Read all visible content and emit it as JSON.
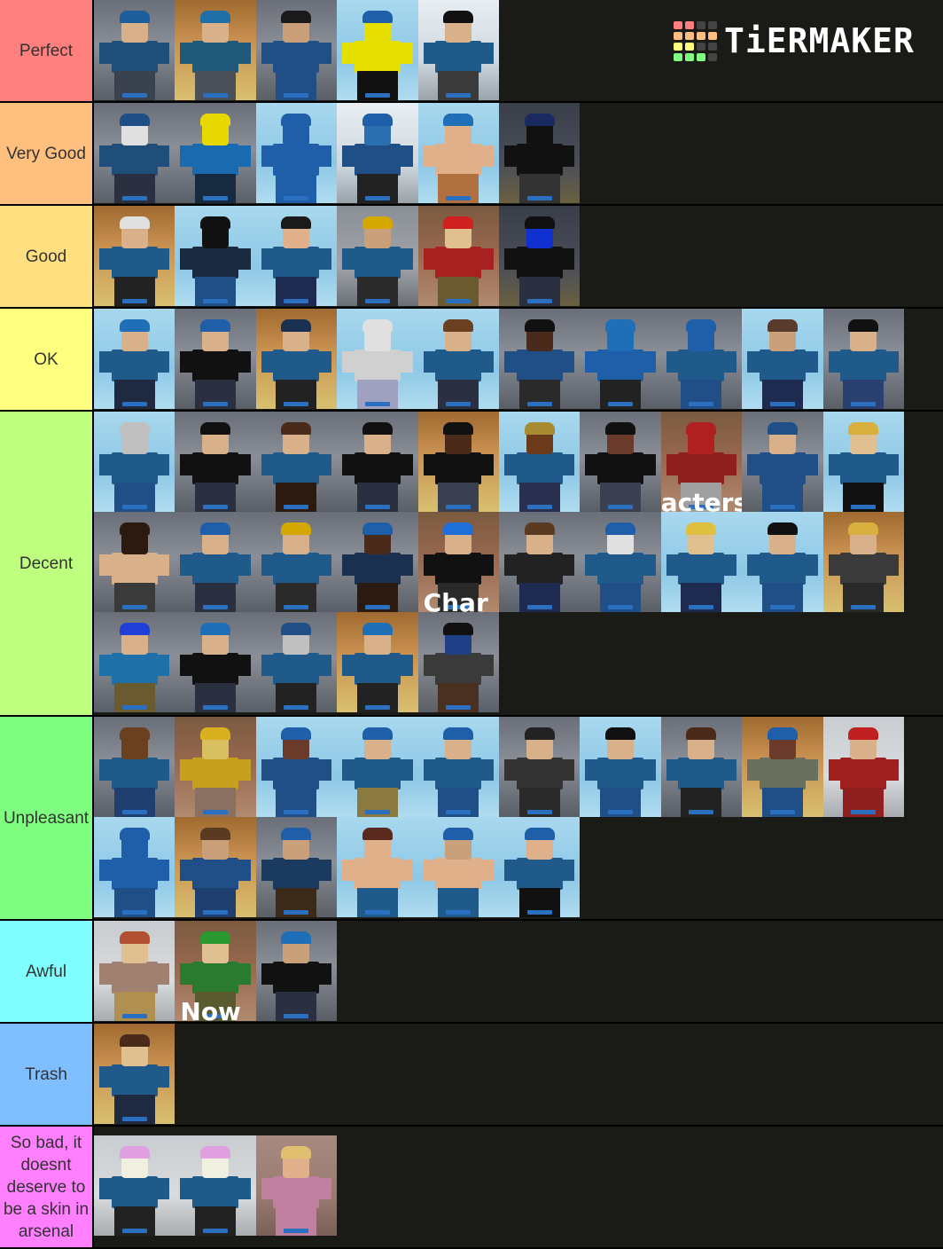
{
  "brand": {
    "name": "TiERMAKER",
    "grid_colors": [
      "#ff7f7f",
      "#ff7f7f",
      "#444444",
      "#444444",
      "#ffbf7f",
      "#ffbf7f",
      "#ffbf7f",
      "#ffbf7f",
      "#ffff7f",
      "#ffff7f",
      "#444444",
      "#444444",
      "#7fff7f",
      "#7fff7f",
      "#7fff7f",
      "#444444"
    ]
  },
  "background_color": "#1a1a17",
  "tiers": [
    {
      "label": "Perfect",
      "color": "#ff7f7f",
      "height_rows": 1,
      "items": [
        {
          "name": "blue-beanie-default",
          "scene": "gray",
          "hat": "#1f5e9c",
          "skin": "#d8b08a",
          "torso": "#1f4e7a",
          "legs": "#3a4250"
        },
        {
          "name": "beanie-sunglasses",
          "scene": "orange",
          "hat": "#1f6fa8",
          "skin": "#d8b08a",
          "torso": "#1f5a7a",
          "legs": "#4a5058"
        },
        {
          "name": "bearded-suit",
          "scene": "gray",
          "hat": "#1a1a1a",
          "skin": "#c9a07a",
          "torso": "#1f4f86",
          "legs": "#1f4f86"
        },
        {
          "name": "noob-grenade",
          "scene": "sky",
          "hat": "#1f5ea8",
          "skin": "#e6e000",
          "torso": "#e6e000",
          "legs": "#111111"
        },
        {
          "name": "agent-pistol",
          "scene": "white",
          "hat": "#111111",
          "skin": "#d8b08a",
          "torso": "#1f5a8a",
          "legs": "#3a3a3a"
        }
      ]
    },
    {
      "label": "Very Good",
      "color": "#ffbf7f",
      "height_rows": 1,
      "items": [
        {
          "name": "skull-mask-hoodie",
          "scene": "gray",
          "hat": "#1f4e86",
          "skin": "#e0e0e0",
          "torso": "#1f4e7a",
          "legs": "#2a3040"
        },
        {
          "name": "noob-smile",
          "scene": "gray",
          "hat": "#e6d800",
          "skin": "#e6d800",
          "torso": "#1a6ab0",
          "legs": "#172a40"
        },
        {
          "name": "brick-wall",
          "scene": "sky",
          "hat": "#1f5ea8",
          "skin": "#1f5ea8",
          "torso": "#1f5ea8",
          "legs": "#1f5ea8"
        },
        {
          "name": "bandana-hat-split",
          "scene": "white",
          "hat": "#1f5ea8",
          "skin": "#2a6fb0",
          "torso": "#1f4f86",
          "legs": "#222222"
        },
        {
          "name": "swim-ring",
          "scene": "sky",
          "hat": "#1f6fb8",
          "skin": "#e0b08a",
          "torso": "#e0b08a",
          "legs": "#b07040"
        },
        {
          "name": "goggles-helmet-black",
          "scene": "dark",
          "hat": "#1a2a60",
          "skin": "#111111",
          "torso": "#111111",
          "legs": "#333333"
        }
      ]
    },
    {
      "label": "Good",
      "color": "#ffdf7f",
      "height_rows": 1,
      "items": [
        {
          "name": "white-helmet-visor",
          "scene": "orange",
          "hat": "#e0e0e0",
          "skin": "#d8b08a",
          "torso": "#1f5a8a",
          "legs": "#222222"
        },
        {
          "name": "tactical-black-armor",
          "scene": "sky",
          "hat": "#111111",
          "skin": "#111111",
          "torso": "#1a2a40",
          "legs": "#1f4f86"
        },
        {
          "name": "lightsaber-mask",
          "scene": "sky",
          "hat": "#1a1a1a",
          "skin": "#e0b08a",
          "torso": "#1f5a8a",
          "legs": "#1f2a50"
        },
        {
          "name": "king-crown-beard",
          "scene": "stair",
          "hat": "#d4a800",
          "skin": "#c9a07a",
          "torso": "#1f5a8a",
          "legs": "#2a2a2a"
        },
        {
          "name": "roblox-shirt-helmet",
          "scene": "brick",
          "hat": "#d02020",
          "skin": "#e0c090",
          "torso": "#a82020",
          "legs": "#6a5a30"
        },
        {
          "name": "blue-visor-mask",
          "scene": "dark",
          "hat": "#111111",
          "skin": "#1030d0",
          "torso": "#111111",
          "legs": "#2a3040"
        }
      ]
    },
    {
      "label": "OK",
      "color": "#ffff7f",
      "height_rows": 1,
      "items": [
        {
          "name": "beanie-rifle-beard",
          "scene": "sky",
          "hat": "#1f6fb8",
          "skin": "#d8b08a",
          "torso": "#1f5a8a",
          "legs": "#1f2a40"
        },
        {
          "name": "beret-vest",
          "scene": "gray",
          "hat": "#1f5ea8",
          "skin": "#d8b08a",
          "torso": "#111111",
          "legs": "#2a3040"
        },
        {
          "name": "police-cap",
          "scene": "orange",
          "hat": "#1a3050",
          "skin": "#d8b08a",
          "torso": "#1f5a8a",
          "legs": "#222222"
        },
        {
          "name": "newspaper-robot",
          "scene": "sky",
          "hat": "#e0e0e0",
          "skin": "#e0e0e0",
          "torso": "#d0d0d0",
          "legs": "#a0a0c0"
        },
        {
          "name": "rifle-soldier",
          "scene": "sky",
          "hat": "#6a4020",
          "skin": "#d8b08a",
          "torso": "#1f5a8a",
          "legs": "#2a3040"
        },
        {
          "name": "bowler-hat-suit",
          "scene": "gray",
          "hat": "#111111",
          "skin": "#4a2a1a",
          "torso": "#1f4f86",
          "legs": "#2a2a2a"
        },
        {
          "name": "ski-mask-tank",
          "scene": "gray",
          "hat": "#1f6fb8",
          "skin": "#1f6fb8",
          "torso": "#1f5ea8",
          "legs": "#222222"
        },
        {
          "name": "full-hood-ninja",
          "scene": "gray",
          "hat": "#1f5ea8",
          "skin": "#1f5ea8",
          "torso": "#1f5a8a",
          "legs": "#1f4f86"
        },
        {
          "name": "cap-beard-hammer",
          "scene": "sky",
          "hat": "#5a3a2a",
          "skin": "#c9a07a",
          "torso": "#1f5a8a",
          "legs": "#1f2a50"
        },
        {
          "name": "long-hair-sunglasses",
          "scene": "gray",
          "hat": "#111111",
          "skin": "#d8b08a",
          "torso": "#1f5a8a",
          "legs": "#2a4070"
        }
      ]
    },
    {
      "label": "Decent",
      "color": "#bfff7f",
      "height_rows": 3,
      "items": [
        {
          "name": "alien-coat",
          "scene": "sky",
          "hat": "#c0c0c0",
          "skin": "#c0c0c0",
          "torso": "#1f5a8a",
          "legs": "#1f4f86"
        },
        {
          "name": "headset-vest-1",
          "scene": "gray",
          "hat": "#111111",
          "skin": "#d8b08a",
          "torso": "#111111",
          "legs": "#2a3040"
        },
        {
          "name": "x-strap-outfit",
          "scene": "gray",
          "hat": "#4a2a1a",
          "skin": "#d8b08a",
          "torso": "#1f5a8a",
          "legs": "#2a1a10"
        },
        {
          "name": "headset-vest-2",
          "scene": "gray",
          "hat": "#111111",
          "skin": "#d8b08a",
          "torso": "#111111",
          "legs": "#2a3040"
        },
        {
          "name": "hooded-vest-dark",
          "scene": "orange",
          "hat": "#111111",
          "skin": "#4a2a1a",
          "torso": "#111111",
          "legs": "#3a4050"
        },
        {
          "name": "straw-hat-rifle",
          "scene": "sky",
          "hat": "#a88a30",
          "skin": "#6a3a1a",
          "torso": "#1f5a8a",
          "legs": "#2a3050"
        },
        {
          "name": "sunglasses-vest-dark",
          "scene": "gray",
          "hat": "#111111",
          "skin": "#6a3a2a",
          "torso": "#111111",
          "legs": "#3a4050"
        },
        {
          "name": "spartan-characters",
          "scene": "brick",
          "hat": "#b02020",
          "skin": "#b02020",
          "torso": "#902020",
          "legs": "#a0a0a0",
          "overlay": "acters"
        },
        {
          "name": "fedora-suit",
          "scene": "gray",
          "hat": "#1f4f86",
          "skin": "#d8b08a",
          "torso": "#1f4f86",
          "legs": "#1f4f86"
        },
        {
          "name": "headset-blonde",
          "scene": "sky",
          "hat": "#d8b040",
          "skin": "#e0c090",
          "torso": "#1f5a8a",
          "legs": "#111111"
        },
        {
          "name": "balaclava-gun",
          "scene": "gray",
          "hat": "#2a1a10",
          "skin": "#2a1a10",
          "torso": "#d8b08a",
          "legs": "#3a3a3a"
        },
        {
          "name": "pirate-hat-coat",
          "scene": "gray",
          "hat": "#1f5ea8",
          "skin": "#d8b08a",
          "torso": "#1f5a8a",
          "legs": "#2a3040"
        },
        {
          "name": "crown-girl",
          "scene": "gray",
          "hat": "#d4a800",
          "skin": "#d8b08a",
          "torso": "#1f5a8a",
          "legs": "#2a2a2a"
        },
        {
          "name": "hard-hat-dark",
          "scene": "gray",
          "hat": "#1f5ea8",
          "skin": "#4a2a1a",
          "torso": "#1a3050",
          "legs": "#2a1a10"
        },
        {
          "name": "blue-helmet-camera",
          "scene": "brick",
          "hat": "#1f6fd8",
          "skin": "#d8b08a",
          "torso": "#111111",
          "legs": "#2a2a2a",
          "overlay": "Char"
        },
        {
          "name": "brown-hair-jacket",
          "scene": "gray",
          "hat": "#5a3a20",
          "skin": "#d8b08a",
          "torso": "#222222",
          "legs": "#1f2a50"
        },
        {
          "name": "wizard-beard",
          "scene": "gray",
          "hat": "#1f5ea8",
          "skin": "#e0e0e0",
          "torso": "#1f5a8a",
          "legs": "#1f4f86"
        },
        {
          "name": "claw-blonde",
          "scene": "sky",
          "hat": "#e0c040",
          "skin": "#e0c090",
          "torso": "#1f5a8a",
          "legs": "#1f2a50"
        },
        {
          "name": "sunglasses-rifle-coat",
          "scene": "sky",
          "hat": "#111111",
          "skin": "#d8b08a",
          "torso": "#1f5a8a",
          "legs": "#1f4f86"
        },
        {
          "name": "headset-gun-blonde",
          "scene": "orange",
          "hat": "#d8b040",
          "skin": "#d8b08a",
          "torso": "#3a3a3a",
          "legs": "#2a2a2a"
        },
        {
          "name": "blue-hair-smile",
          "scene": "gray",
          "hat": "#1f3fd8",
          "skin": "#d8b08a",
          "torso": "#1f6fa8",
          "legs": "#6a5a30"
        },
        {
          "name": "beanie-vest-smirk",
          "scene": "gray",
          "hat": "#1f6fb8",
          "skin": "#d8b08a",
          "torso": "#111111",
          "legs": "#2a3040"
        },
        {
          "name": "teeth-mask-hood",
          "scene": "gray",
          "hat": "#1f4f86",
          "skin": "#c0c0c0",
          "torso": "#1f5a8a",
          "legs": "#222222"
        },
        {
          "name": "eyepatch-beret",
          "scene": "orange",
          "hat": "#1f6fb8",
          "skin": "#d8b08a",
          "torso": "#1f5a8a",
          "legs": "#222222"
        },
        {
          "name": "cowgirl-bandana",
          "scene": "gray",
          "hat": "#111111",
          "skin": "#1f3f86",
          "torso": "#3a3a3a",
          "legs": "#4a3020"
        }
      ]
    },
    {
      "label": "Unpleasant",
      "color": "#7fff7f",
      "height_rows": 2,
      "items": [
        {
          "name": "bearded-lumberjack",
          "scene": "gray",
          "hat": "#6a4020",
          "skin": "#6a4020",
          "torso": "#1f5a8a",
          "legs": "#1f3f70"
        },
        {
          "name": "chef-gold",
          "scene": "brick",
          "hat": "#d8b020",
          "skin": "#d8c060",
          "torso": "#c8a020",
          "legs": "#8a7060"
        },
        {
          "name": "firefighter",
          "scene": "sky",
          "hat": "#1f5ea8",
          "skin": "#6a3a2a",
          "torso": "#1f4f86",
          "legs": "#1f4f86"
        },
        {
          "name": "beanie-shotgun",
          "scene": "sky",
          "hat": "#1f5ea8",
          "skin": "#d8b08a",
          "torso": "#1f5a8a",
          "legs": "#8a7a40"
        },
        {
          "name": "mustache-cap",
          "scene": "sky",
          "hat": "#1f5ea8",
          "skin": "#d8b08a",
          "torso": "#1f5a8a",
          "legs": "#1f4f86"
        },
        {
          "name": "cowboy-vest",
          "scene": "gray",
          "hat": "#222222",
          "skin": "#d8b08a",
          "torso": "#333333",
          "legs": "#2a2a2a"
        },
        {
          "name": "top-hat-masked",
          "scene": "sky",
          "hat": "#111111",
          "skin": "#d8b08a",
          "torso": "#1f5a8a",
          "legs": "#1f4f86"
        },
        {
          "name": "hoodie-brown-hair",
          "scene": "gray",
          "hat": "#4a2a1a",
          "skin": "#d8b08a",
          "torso": "#1f5a8a",
          "legs": "#222222"
        },
        {
          "name": "witch-hat-poncho",
          "scene": "orange",
          "hat": "#1f5ea8",
          "skin": "#6a3a2a",
          "torso": "#6a7060",
          "legs": "#1f4f86"
        },
        {
          "name": "red-hood-megaphone",
          "scene": "light",
          "hat": "#c02020",
          "skin": "#d8b08a",
          "torso": "#a02020",
          "legs": "#902020"
        },
        {
          "name": "blue-hood-pistol",
          "scene": "sky",
          "hat": "#1f5ea8",
          "skin": "#1f5ea8",
          "torso": "#1f5ea8",
          "legs": "#1f4f86"
        },
        {
          "name": "eyepatch-suspenders",
          "scene": "orange",
          "hat": "#5a3a20",
          "skin": "#c9a07a",
          "torso": "#1f4f86",
          "legs": "#1f3f70"
        },
        {
          "name": "hard-hat-poncho",
          "scene": "gray",
          "hat": "#1f5ea8",
          "skin": "#c9a07a",
          "torso": "#1a3a60",
          "legs": "#3a2a1a"
        },
        {
          "name": "banana-shirtless",
          "scene": "sky",
          "hat": "#5a2a20",
          "skin": "#e0b08a",
          "torso": "#e0b08a",
          "legs": "#1f5a8a"
        },
        {
          "name": "shirtless-sunglasses",
          "scene": "sky",
          "hat": "#1f5ea8",
          "skin": "#c9a07a",
          "torso": "#e0b08a",
          "legs": "#1f5a8a"
        },
        {
          "name": "headband-tank",
          "scene": "sky",
          "hat": "#1f5ea8",
          "skin": "#e0b08a",
          "torso": "#1f5a8a",
          "legs": "#111111"
        }
      ]
    },
    {
      "label": "Awful",
      "color": "#7fffff",
      "height_rows": 1,
      "items": [
        {
          "name": "megaphone-sweater",
          "scene": "light",
          "hat": "#b05030",
          "skin": "#e0c090",
          "torso": "#a08070",
          "legs": "#b09050"
        },
        {
          "name": "green-cap-racket",
          "scene": "brick",
          "hat": "#2a9a30",
          "skin": "#e0c090",
          "torso": "#2a7a30",
          "legs": "#5a5a30",
          "overlay": "Now"
        },
        {
          "name": "beanie-beard-vest",
          "scene": "gray",
          "hat": "#1f6fb8",
          "skin": "#c9a07a",
          "torso": "#111111",
          "legs": "#2a3040"
        }
      ]
    },
    {
      "label": "Trash",
      "color": "#7fbfff",
      "height_rows": 1,
      "items": [
        {
          "name": "headphones-hoodie",
          "scene": "orange",
          "hat": "#4a2a1a",
          "skin": "#e0c090",
          "torso": "#1f5a8a",
          "legs": "#1f2a40"
        }
      ]
    },
    {
      "label": "So bad, it doesnt deserve to be a skin in arsenal",
      "color": "#ff7fff",
      "height_rows": 1,
      "items": [
        {
          "name": "pink-hair-uniform-1",
          "scene": "light",
          "hat": "#e0a0e0",
          "skin": "#f0f0e0",
          "torso": "#1f5a8a",
          "legs": "#222222"
        },
        {
          "name": "pink-hair-uniform-2",
          "scene": "light",
          "hat": "#e0a0e0",
          "skin": "#f0f0e0",
          "torso": "#1f5a8a",
          "legs": "#222222"
        },
        {
          "name": "blonde-pink-dress",
          "scene": "mauve",
          "hat": "#e0c070",
          "skin": "#e0b08a",
          "torso": "#c080a0",
          "legs": "#c080a0"
        }
      ]
    }
  ]
}
